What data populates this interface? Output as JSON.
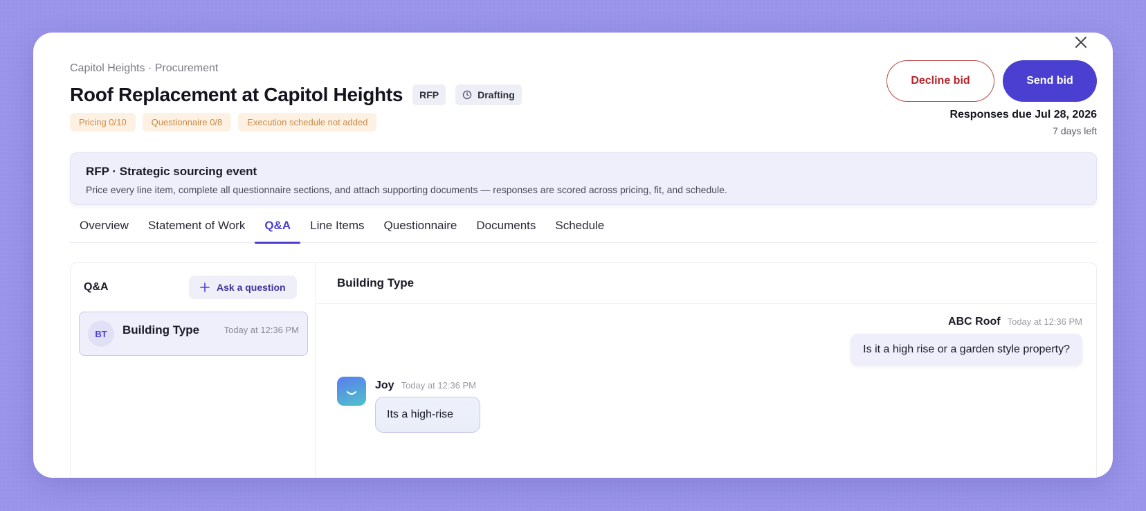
{
  "header": {
    "breadcrumb": "Capitol Heights · Procurement",
    "title": "Roof Replacement at Capitol Heights",
    "type_tag": "RFP",
    "status_tag": "Drafting",
    "badges": [
      "Pricing 0/10",
      "Questionnaire 0/8",
      "Execution schedule not added"
    ],
    "decline_label": "Decline bid",
    "send_label": "Send bid",
    "due": "Responses due Jul 28, 2026",
    "days_left": "7 days left"
  },
  "info": {
    "title": "RFP · Strategic sourcing event",
    "description": "Price every line item, complete all questionnaire sections, and attach supporting documents — responses are scored across pricing, fit, and schedule."
  },
  "tabs": [
    {
      "label": "Overview",
      "active": false
    },
    {
      "label": "Statement of Work",
      "active": false
    },
    {
      "label": "Q&A",
      "active": true
    },
    {
      "label": "Line Items",
      "active": false
    },
    {
      "label": "Questionnaire",
      "active": false
    },
    {
      "label": "Documents",
      "active": false
    },
    {
      "label": "Schedule",
      "active": false
    }
  ],
  "qa": {
    "heading": "Q&A",
    "ask_label": "Ask a question",
    "questions": [
      {
        "initials": "BT",
        "title": "Building Type",
        "time": "Today at 12:36 PM"
      }
    ]
  },
  "thread": {
    "title": "Building Type",
    "messages": [
      {
        "sender": "ABC Roof",
        "time": "Today at 12:36 PM",
        "text": "Is it a high rise or a garden style property?"
      },
      {
        "sender": "Joy",
        "time": "Today at 12:36 PM",
        "text": "Its a high-rise"
      }
    ]
  },
  "colors": {
    "accent": "#4a3fd0",
    "decline": "#b3262b",
    "badge_text": "#c88a45",
    "backdrop": "#9a95ea"
  }
}
